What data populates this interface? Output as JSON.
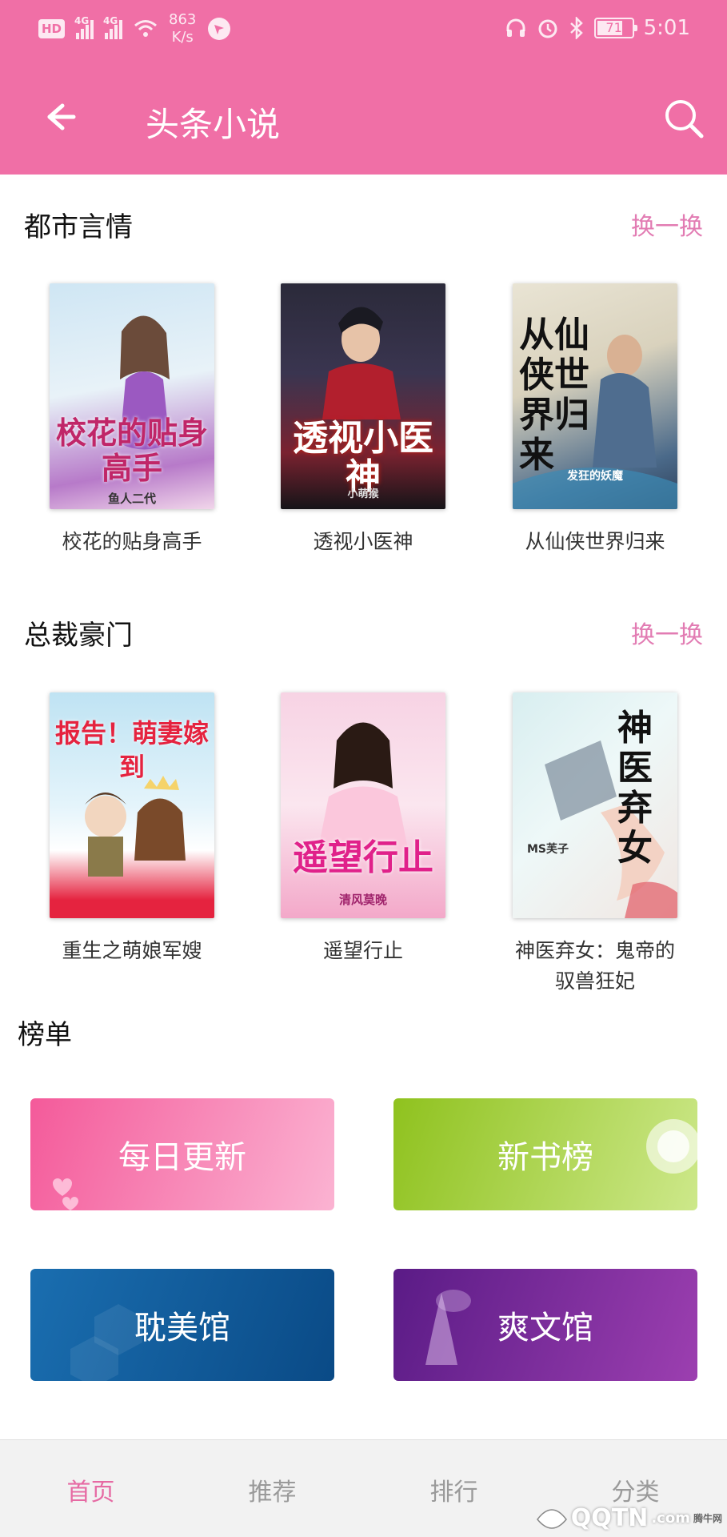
{
  "status_bar": {
    "hd": "HD",
    "net1": "4G",
    "net2": "4G",
    "speed_value": "863",
    "speed_unit": "K/s",
    "battery": "71",
    "battery_level": 0.71,
    "time": "5:01"
  },
  "header": {
    "title": "头条小说"
  },
  "sections": [
    {
      "title": "都市言情",
      "swap_label": "换一换",
      "books": [
        {
          "title": "校花的贴身高手",
          "cover_text": "校花的贴身高手",
          "cover_author": "鱼人二代",
          "colors": [
            "#cfe6f4",
            "#b77ac9"
          ]
        },
        {
          "title": "透视小医神",
          "cover_text": "透视小医神",
          "cover_author": "小萌猴",
          "colors": [
            "#2b2a3a",
            "#7a2230"
          ]
        },
        {
          "title": "从仙侠世界归来",
          "cover_text": "从仙侠世界归来",
          "cover_author": "发狂的妖魔",
          "colors": [
            "#e9e4d4",
            "#4b6a8a"
          ]
        }
      ]
    },
    {
      "title": "总裁豪门",
      "swap_label": "换一换",
      "books": [
        {
          "title": "重生之萌娘军嫂",
          "cover_text": "报告！萌妻嫁到",
          "cover_author": "",
          "colors": [
            "#bfe3f3",
            "#f5d36a"
          ]
        },
        {
          "title": "遥望行止",
          "cover_text": "遥望行止",
          "cover_author": "清风莫晚",
          "colors": [
            "#f7d3e4",
            "#f3a8c9"
          ]
        },
        {
          "title": "神医弃女：鬼帝的驭兽狂妃",
          "cover_text": "神医弃女",
          "cover_author": "MS芙子",
          "colors": [
            "#d8eef0",
            "#f1e6e1"
          ]
        }
      ]
    }
  ],
  "rankings": {
    "title": "榜单",
    "items": [
      {
        "label": "每日更新",
        "colors": [
          "#f45a9a",
          "#fbb3d2"
        ]
      },
      {
        "label": "新书榜",
        "colors": [
          "#8fc21e",
          "#cde88a"
        ]
      },
      {
        "label": "耽美馆",
        "colors": [
          "#1a6eb0",
          "#0a4a86"
        ]
      },
      {
        "label": "爽文馆",
        "colors": [
          "#5a1b86",
          "#9c3fb0"
        ]
      }
    ]
  },
  "tabs": [
    {
      "label": "首页",
      "active": true
    },
    {
      "label": "推荐",
      "active": false
    },
    {
      "label": "排行",
      "active": false
    },
    {
      "label": "分类",
      "active": false
    }
  ],
  "watermark": {
    "logo": "QQTN",
    "suffix": ".com",
    "tag": "腾牛网"
  },
  "colors": {
    "primary": "#f06fa6",
    "accent_text": "#e27cb3",
    "tab_active": "#e66aa3"
  }
}
